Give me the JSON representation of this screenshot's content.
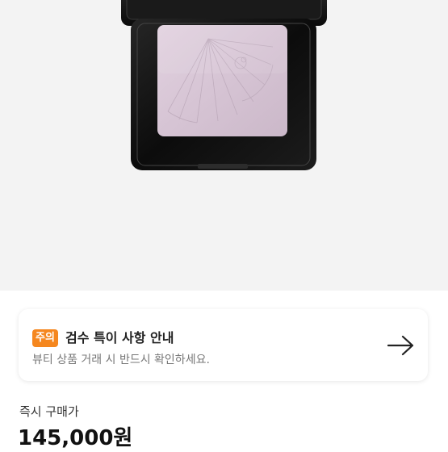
{
  "colors": {
    "hero_background": "#f3f3f3",
    "badge_background": "#f5871f",
    "compact_case": "#111111",
    "powder": "#d8c6d6"
  },
  "notice": {
    "badge": "주의",
    "title": "검수 특이 사항 안내",
    "subtitle": "뷰티 상품 거래 시 반드시 확인하세요.",
    "icon": "arrow-right-icon"
  },
  "price": {
    "label": "즉시 구매가",
    "value": "145,000원"
  }
}
